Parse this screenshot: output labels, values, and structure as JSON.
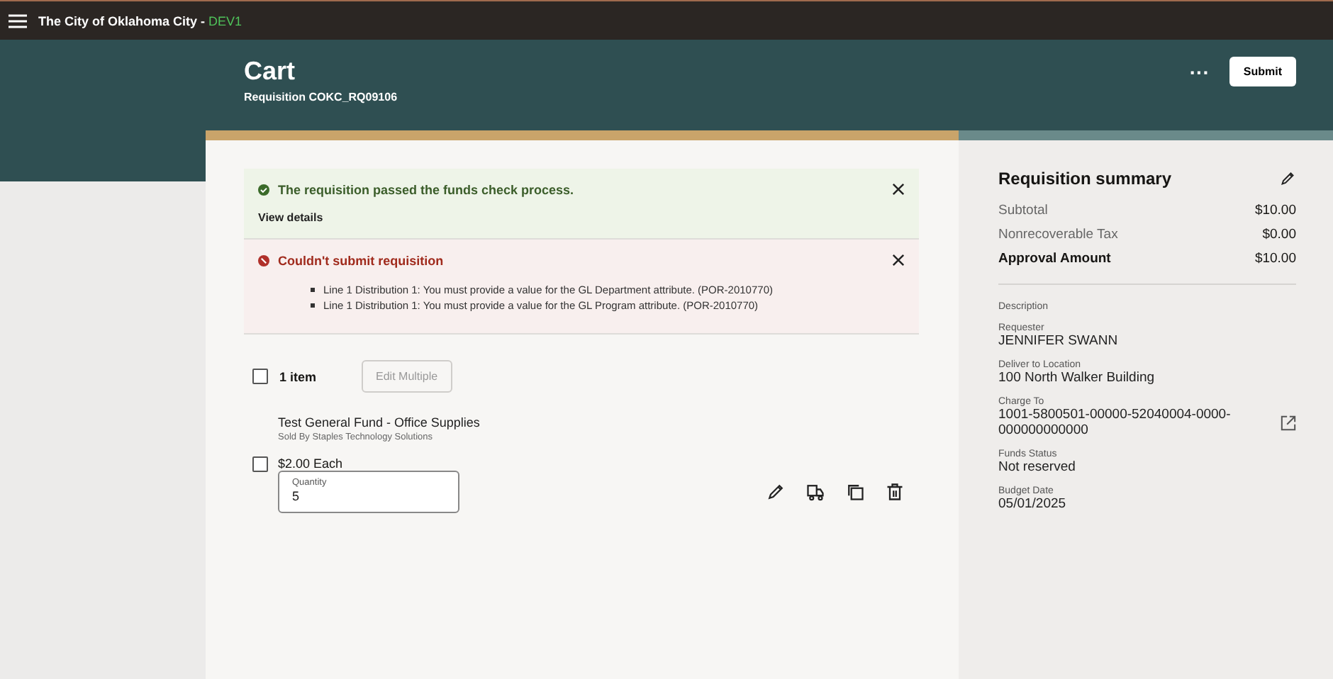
{
  "top_bar": {
    "org": "The City of Oklahoma City -",
    "env": "DEV1"
  },
  "header": {
    "title": "Cart",
    "subtitle": "Requisition COKC_RQ09106",
    "more": "···",
    "submit": "Submit"
  },
  "messages": [
    {
      "kind": "success",
      "title": "The requisition passed the funds check process.",
      "link": "View details"
    },
    {
      "kind": "error",
      "title": "Couldn't submit requisition",
      "items": [
        "Line 1 Distribution 1: You must provide a value for the GL Department attribute. (POR-2010770)",
        "Line 1 Distribution 1: You must provide a value for the GL Program attribute. (POR-2010770)"
      ]
    }
  ],
  "list_header": {
    "checked": false,
    "count": "1 item",
    "edit_multiple": "Edit Multiple",
    "edit_disabled": true
  },
  "lines": [
    {
      "checked": false,
      "name": "Test General Fund - Office Supplies",
      "supplier": "Sold By Staples Technology Solutions",
      "price": "$2.00 Each",
      "quantity_label": "Quantity",
      "quantity": "5"
    }
  ],
  "summary": {
    "title": "Requisition summary",
    "totals": [
      {
        "label": "Subtotal",
        "value": "$10.00",
        "bold": false
      },
      {
        "label": "Nonrecoverable Tax",
        "value": "$0.00",
        "bold": false
      },
      {
        "label": "Approval Amount",
        "value": "$10.00",
        "bold": true
      }
    ],
    "fields": [
      {
        "label": "Description"
      },
      {
        "label": "Requester",
        "value": "JENNIFER SWANN"
      },
      {
        "label": "Deliver to Location",
        "value": "100 North Walker Building"
      },
      {
        "label": "Charge To",
        "value": "1001-5800501-00000-52040004-0000-000000000000",
        "link": true
      },
      {
        "label": "Funds Status",
        "value": "Not reserved"
      },
      {
        "label": "Budget Date",
        "value": "05/01/2025"
      }
    ]
  }
}
